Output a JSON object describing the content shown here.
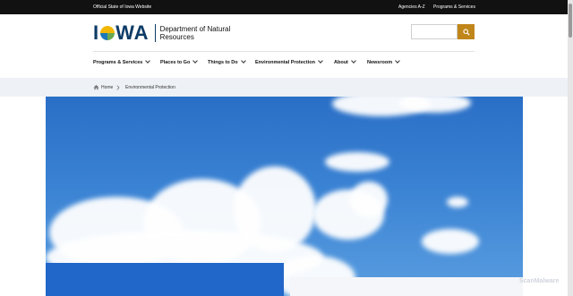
{
  "topbar": {
    "official_label": "Official State of Iowa Website",
    "links": [
      "Agencies A-Z",
      "Programs & Services"
    ]
  },
  "logo": {
    "word_left": "I",
    "word_right": "WA",
    "department_line1": "Department of Natural",
    "department_line2": "Resources"
  },
  "search": {
    "placeholder": ""
  },
  "nav": {
    "items": [
      {
        "label": "Programs & Services"
      },
      {
        "label": "Places to Go"
      },
      {
        "label": "Things to Do"
      },
      {
        "label": "Environmental Protection"
      },
      {
        "label": "About"
      },
      {
        "label": "Newsroom"
      }
    ]
  },
  "breadcrumb": {
    "home_label": "Home",
    "current_label": "Environmental Protection"
  },
  "watermark": "ScanMalware",
  "colors": {
    "topbar": "#111111",
    "brand_navy": "#0d3b66",
    "search_button": "#c0861a",
    "hero_sky": "#2f74c9",
    "overlay_blue": "#2166c9"
  }
}
